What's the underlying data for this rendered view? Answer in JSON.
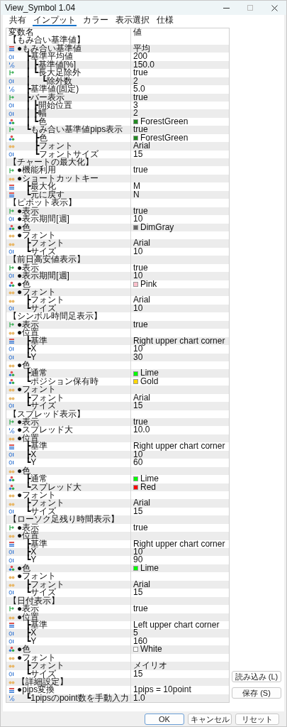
{
  "window": {
    "title": "View_Symbol 1.04"
  },
  "tabs": [
    {
      "label": "共有",
      "selected": false
    },
    {
      "label": "インプット",
      "selected": true
    },
    {
      "label": "カラー",
      "selected": false
    },
    {
      "label": "表示選択",
      "selected": false
    },
    {
      "label": "仕様",
      "selected": false
    }
  ],
  "table": {
    "columns": [
      "変数名",
      "値"
    ],
    "rows": [
      {
        "kind": "section",
        "name": "【もみ合い基準値】"
      },
      {
        "kind": "enum",
        "name": "●もみ合い基準値",
        "value": "平均"
      },
      {
        "kind": "int",
        "name": "　┣基準平均値",
        "value": "200"
      },
      {
        "kind": "double",
        "name": "　┃ ┣基準値[%]",
        "value": "150.0"
      },
      {
        "kind": "bool",
        "name": "　┃ ┗長大足除外",
        "value": "true"
      },
      {
        "kind": "int",
        "name": "　┃　 ┗除外数",
        "value": "2"
      },
      {
        "kind": "double",
        "name": "　┣基準値(固定)",
        "value": "5.0"
      },
      {
        "kind": "bool",
        "name": "　┣バー表示",
        "value": "true"
      },
      {
        "kind": "int",
        "name": "　┃ ┣開始位置",
        "value": "3"
      },
      {
        "kind": "int",
        "name": "　┃ ┣幅",
        "value": "2"
      },
      {
        "kind": "color",
        "name": "　┃ ┗色",
        "value": "ForestGreen",
        "color": "#228b22"
      },
      {
        "kind": "bool",
        "name": "　┗もみ合い基準値pips表示",
        "value": "true"
      },
      {
        "kind": "color",
        "name": "　　┣色",
        "value": "ForestGreen",
        "color": "#228b22"
      },
      {
        "kind": "string",
        "name": "　　┣フォント",
        "value": "Arial"
      },
      {
        "kind": "int",
        "name": "　　┗フォントサイズ",
        "value": "15"
      },
      {
        "kind": "section",
        "name": "【チャートの最大化】"
      },
      {
        "kind": "bool",
        "name": "●機能利用",
        "value": "true"
      },
      {
        "kind": "string",
        "name": "●ショートカットキー"
      },
      {
        "kind": "enum",
        "name": "　┣最大化",
        "value": "M"
      },
      {
        "kind": "enum",
        "name": "　┗元に戻す",
        "value": "N"
      },
      {
        "kind": "section",
        "name": "【ピボット表示】"
      },
      {
        "kind": "bool",
        "name": "●表示",
        "value": "true"
      },
      {
        "kind": "int",
        "name": "●表示期間[週]",
        "value": "10"
      },
      {
        "kind": "color",
        "name": "●色",
        "value": "DimGray",
        "color": "#696969"
      },
      {
        "kind": "string",
        "name": "●フォント"
      },
      {
        "kind": "string",
        "name": "　┣フォント",
        "value": "Arial"
      },
      {
        "kind": "int",
        "name": "　┗サイズ",
        "value": "10"
      },
      {
        "kind": "section",
        "name": "【前日高安値表示】"
      },
      {
        "kind": "bool",
        "name": "●表示",
        "value": "true"
      },
      {
        "kind": "int",
        "name": "●表示期間[週]",
        "value": "10"
      },
      {
        "kind": "color",
        "name": "●色",
        "value": "Pink",
        "color": "#ffc0cb"
      },
      {
        "kind": "string",
        "name": "●フォント"
      },
      {
        "kind": "string",
        "name": "　┣フォント",
        "value": "Arial"
      },
      {
        "kind": "int",
        "name": "　┗サイズ",
        "value": "10"
      },
      {
        "kind": "section",
        "name": "【シンボル時間足表示】"
      },
      {
        "kind": "bool",
        "name": "●表示",
        "value": "true"
      },
      {
        "kind": "string",
        "name": "●位置"
      },
      {
        "kind": "enum",
        "name": "　┣基準",
        "value": "Right upper chart corner"
      },
      {
        "kind": "int",
        "name": "　┣X",
        "value": "10"
      },
      {
        "kind": "int",
        "name": "　┗Y",
        "value": "30"
      },
      {
        "kind": "string",
        "name": "●色"
      },
      {
        "kind": "color",
        "name": "　┣通常",
        "value": "Lime",
        "color": "#00ff00"
      },
      {
        "kind": "color",
        "name": "　┗ポジション保有時",
        "value": "Gold",
        "color": "#ffd700"
      },
      {
        "kind": "string",
        "name": "●フォント"
      },
      {
        "kind": "string",
        "name": "　┣フォント",
        "value": "Arial"
      },
      {
        "kind": "int",
        "name": "　┗サイズ",
        "value": "15"
      },
      {
        "kind": "section",
        "name": "【スプレッド表示】"
      },
      {
        "kind": "bool",
        "name": "●表示",
        "value": "true"
      },
      {
        "kind": "double",
        "name": "●スプレッド大",
        "value": "10.0"
      },
      {
        "kind": "string",
        "name": "●位置"
      },
      {
        "kind": "enum",
        "name": "　┣基準",
        "value": "Right upper chart corner"
      },
      {
        "kind": "int",
        "name": "　┣X",
        "value": "10"
      },
      {
        "kind": "int",
        "name": "　┗Y",
        "value": "60"
      },
      {
        "kind": "string",
        "name": "●色"
      },
      {
        "kind": "color",
        "name": "　┣通常",
        "value": "Lime",
        "color": "#00ff00"
      },
      {
        "kind": "color",
        "name": "　┗スプレッド大",
        "value": "Red",
        "color": "#ff0000"
      },
      {
        "kind": "string",
        "name": "●フォント"
      },
      {
        "kind": "string",
        "name": "　┣フォント",
        "value": "Arial"
      },
      {
        "kind": "int",
        "name": "　┗サイズ",
        "value": "15"
      },
      {
        "kind": "section",
        "name": "【ローソク足残り時間表示】"
      },
      {
        "kind": "bool",
        "name": "●表示",
        "value": "true"
      },
      {
        "kind": "string",
        "name": "●位置"
      },
      {
        "kind": "enum",
        "name": "　┣基準",
        "value": "Right upper chart corner"
      },
      {
        "kind": "int",
        "name": "　┣X",
        "value": "10"
      },
      {
        "kind": "int",
        "name": "　┗Y",
        "value": "90"
      },
      {
        "kind": "color",
        "name": "●色",
        "value": "Lime",
        "color": "#00ff00"
      },
      {
        "kind": "string",
        "name": "●フォント"
      },
      {
        "kind": "string",
        "name": "　┣フォント",
        "value": "Arial"
      },
      {
        "kind": "int",
        "name": "　┗サイズ",
        "value": "15"
      },
      {
        "kind": "section",
        "name": "【日付表示】"
      },
      {
        "kind": "bool",
        "name": "●表示",
        "value": "true"
      },
      {
        "kind": "string",
        "name": "●位置"
      },
      {
        "kind": "enum",
        "name": "　┣基準",
        "value": "Left upper chart corner"
      },
      {
        "kind": "int",
        "name": "　┣X",
        "value": "5"
      },
      {
        "kind": "int",
        "name": "　┗Y",
        "value": "160"
      },
      {
        "kind": "color",
        "name": "●色",
        "value": "White",
        "color": "#ffffff"
      },
      {
        "kind": "string",
        "name": "●フォント"
      },
      {
        "kind": "string",
        "name": "　┣フォント",
        "value": "メイリオ"
      },
      {
        "kind": "int",
        "name": "　┗サイズ",
        "value": "15"
      },
      {
        "kind": "string",
        "name": "【詳細設定】"
      },
      {
        "kind": "enum",
        "name": "●pips変換",
        "value": "1pips = 10point"
      },
      {
        "kind": "double",
        "name": "　┗1pipsのpoint数を手動入力",
        "value": "1.0"
      }
    ]
  },
  "side_buttons": [
    "読み込み (L)",
    "保存 (S)"
  ],
  "buttons": [
    {
      "label": "OK",
      "primary": true
    },
    {
      "label": "キャンセル",
      "primary": false
    },
    {
      "label": "リセット",
      "primary": false
    }
  ]
}
